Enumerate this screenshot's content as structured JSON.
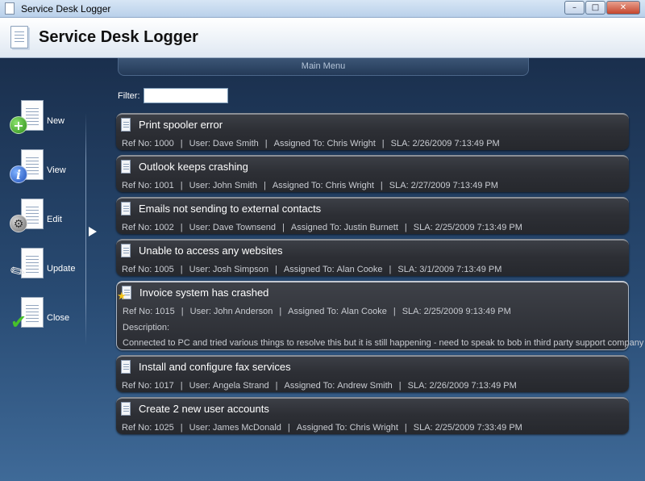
{
  "window": {
    "title": "Service Desk Logger",
    "min": "–",
    "max": "□",
    "close": "✕"
  },
  "header": {
    "title": "Service Desk Logger",
    "icon": "document-icon"
  },
  "main_menu": {
    "label": "Main Menu"
  },
  "sidebar": {
    "items": [
      {
        "label": "New",
        "icon": "add-icon",
        "glyph": "+"
      },
      {
        "label": "View",
        "icon": "info-icon",
        "glyph": "i"
      },
      {
        "label": "Edit",
        "icon": "gear-icon",
        "glyph": "⚙"
      },
      {
        "label": "Update",
        "icon": "pen-icon",
        "glyph": "✎"
      },
      {
        "label": "Close",
        "icon": "checkmark-icon",
        "glyph": "✔"
      }
    ]
  },
  "filter": {
    "label": "Filter:",
    "value": ""
  },
  "fields": {
    "ref": "Ref No:",
    "user": "User:",
    "assigned": "Assigned To:",
    "sla": "SLA:",
    "description": "Description:",
    "separator": "|"
  },
  "tickets": [
    {
      "title": "Print spooler error",
      "ref": "1000",
      "user": "Dave Smith",
      "assigned": "Chris Wright",
      "sla": "2/26/2009 7:13:49 PM"
    },
    {
      "title": "Outlook keeps crashing",
      "ref": "1001",
      "user": "John Smith",
      "assigned": "Chris Wright",
      "sla": "2/27/2009 7:13:49 PM"
    },
    {
      "title": "Emails not sending to external contacts",
      "ref": "1002",
      "user": "Dave Townsend",
      "assigned": "Justin Burnett",
      "sla": "2/25/2009 7:13:49 PM"
    },
    {
      "title": "Unable to access any websites",
      "ref": "1005",
      "user": "Josh Simpson",
      "assigned": "Alan Cooke",
      "sla": "3/1/2009 7:13:49 PM"
    },
    {
      "title": "Invoice system has crashed",
      "ref": "1015",
      "user": "John Anderson",
      "assigned": "Alan Cooke",
      "sla": "2/25/2009 9:13:49 PM",
      "description": "Connected to PC and tried various things to resolve this but it is still happening - need to speak to bob in third party support company",
      "starred": "★"
    },
    {
      "title": "Install and configure fax services",
      "ref": "1017",
      "user": "Angela Strand",
      "assigned": "Andrew Smith",
      "sla": "2/26/2009 7:13:49 PM"
    },
    {
      "title": "Create 2 new user accounts",
      "ref": "1025",
      "user": "James McDonald",
      "assigned": "Chris Wright",
      "sla": "2/25/2009 7:33:49 PM"
    }
  ]
}
